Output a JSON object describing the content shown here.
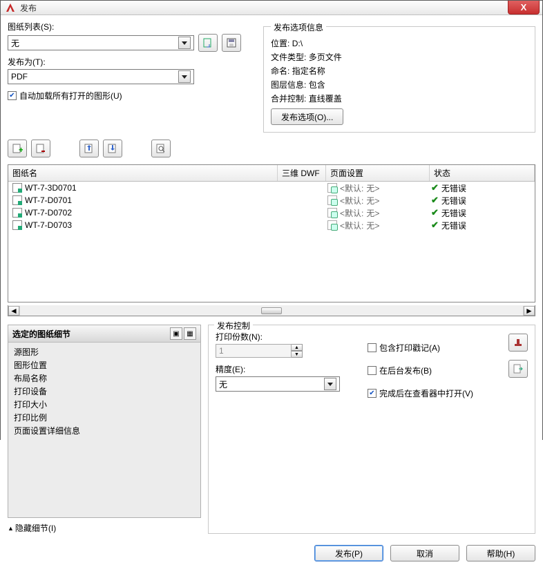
{
  "window": {
    "title": "发布"
  },
  "left": {
    "sheet_list_label": "图纸列表(S):",
    "sheet_list_value": "无",
    "publish_as_label": "发布为(T):",
    "publish_as_value": "PDF",
    "auto_load_label": "自动加载所有打开的图形(U)"
  },
  "info": {
    "heading": "发布选项信息",
    "lines": {
      "location_label": "位置:",
      "location_value": "D:\\",
      "filetype_label": "文件类型:",
      "filetype_value": "多页文件",
      "naming_label": "命名:",
      "naming_value": "指定名称",
      "layer_label": "图层信息:",
      "layer_value": "包含",
      "merge_label": "合并控制:",
      "merge_value": "直线覆盖"
    },
    "options_btn": "发布选项(O)..."
  },
  "table": {
    "headers": {
      "c1": "图纸名",
      "c2": "三维 DWF",
      "c3": "页面设置",
      "c4": "状态"
    },
    "default_prefix": "默认:",
    "default_value": "无>",
    "status_ok": "无错误",
    "rows": [
      {
        "name": "WT-7-3D0701"
      },
      {
        "name": "WT-7-D0701"
      },
      {
        "name": "WT-7-D0702"
      },
      {
        "name": "WT-7-D0703"
      }
    ]
  },
  "details": {
    "heading": "选定的图纸细节",
    "items": {
      "a": "源图形",
      "b": "图形位置",
      "c": "布局名称",
      "d": "打印设备",
      "e": "打印大小",
      "f": "打印比例",
      "g": "页面设置详细信息"
    }
  },
  "hide_details": "隐藏细节(I)",
  "pub": {
    "heading": "发布控制",
    "copies_label": "打印份数(N):",
    "copies_value": "1",
    "precision_label": "精度(E):",
    "precision_value": "无",
    "include_stamp": "包含打印戳记(A)",
    "background": "在后台发布(B)",
    "open_viewer": "完成后在查看器中打开(V)"
  },
  "footer": {
    "publish": "发布(P)",
    "cancel": "取消",
    "help": "帮助(H)"
  }
}
